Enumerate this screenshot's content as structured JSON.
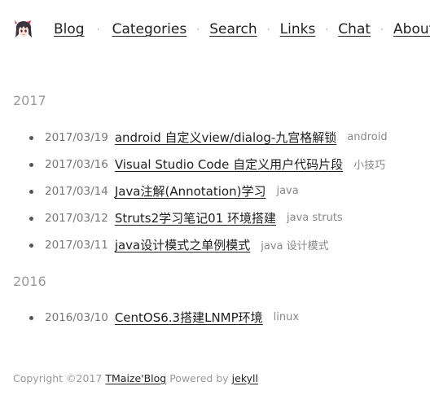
{
  "nav": {
    "avatar_icon": "anime-girl-avatar-icon",
    "items": [
      "Blog",
      "Categories",
      "Search",
      "Links",
      "Chat",
      "About"
    ],
    "separator": "·"
  },
  "archive": [
    {
      "year": "2017",
      "posts": [
        {
          "date": "2017/03/19",
          "title": "android 自定义view/dialog-九宫格解锁",
          "tags": "android"
        },
        {
          "date": "2017/03/16",
          "title": "Visual Studio Code 自定义用户代码片段",
          "tags": "小技巧"
        },
        {
          "date": "2017/03/14",
          "title": "Java注解(Annotation)学习",
          "tags": "java"
        },
        {
          "date": "2017/03/12",
          "title": "Struts2学习笔记01 环境搭建",
          "tags": "java struts"
        },
        {
          "date": "2017/03/11",
          "title": "java设计模式之单例模式",
          "tags": "java 设计模式"
        }
      ]
    },
    {
      "year": "2016",
      "posts": [
        {
          "date": "2016/03/10",
          "title": "CentOS6.3搭建LNMP环境",
          "tags": "linux"
        }
      ]
    }
  ],
  "footer": {
    "prefix": "Copyright ©2017",
    "site_name": "TMaize'Blog",
    "powered_by": "Powered by",
    "engine": "jekyll"
  }
}
